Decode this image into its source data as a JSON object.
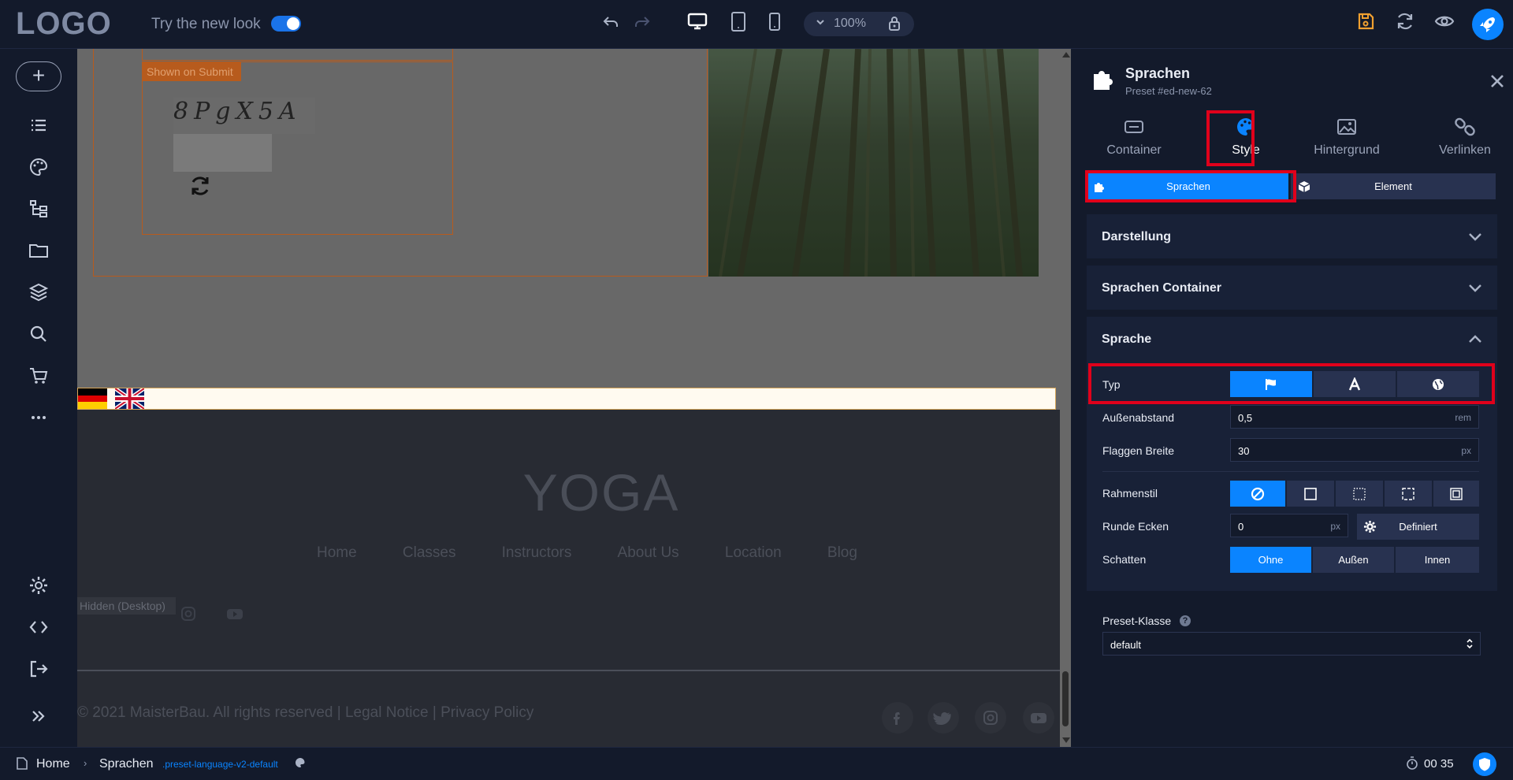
{
  "topbar": {
    "logo": "LOGO",
    "new_look_label": "Try the new look",
    "zoom": "100%"
  },
  "canvas": {
    "shown_on_submit": "Shown on Submit",
    "captcha_text": "8PgX5A",
    "yoga_title": "YOGA",
    "nav": [
      "Home",
      "Classes",
      "Instructors",
      "About Us",
      "Location",
      "Blog"
    ],
    "hidden_label": "Hidden (Desktop)",
    "copyright": "© 2021 MaisterBau. All rights reserved | Legal Notice | Privacy Policy"
  },
  "panel": {
    "title": "Sprachen",
    "subtitle": "Preset #ed-new-62",
    "tabs": [
      "Container",
      "Style",
      "Hintergrund",
      "Verlinken"
    ],
    "segments": [
      "Sprachen",
      "Element"
    ],
    "sections": [
      "Darstellung",
      "Sprachen Container",
      "Sprache"
    ],
    "typ_label": "Typ",
    "aussenabstand_label": "Außenabstand",
    "aussenabstand_value": "0,5",
    "aussenabstand_unit": "rem",
    "flaggen_label": "Flaggen Breite",
    "flaggen_value": "30",
    "flaggen_unit": "px",
    "rahmenstil_label": "Rahmenstil",
    "runde_label": "Runde Ecken",
    "runde_value": "0",
    "runde_unit": "px",
    "definiert": "Definiert",
    "schatten_label": "Schatten",
    "schatten_options": [
      "Ohne",
      "Außen",
      "Innen"
    ],
    "preset_label": "Preset-Klasse",
    "preset_value": "default"
  },
  "footerbar": {
    "home": "Home",
    "sprachen": "Sprachen",
    "preset_class": ".preset-language-v2-default",
    "timer": "00 35"
  },
  "colors": {
    "accent": "#0a84ff",
    "highlight": "#e0001b",
    "save": "#f0a030"
  }
}
